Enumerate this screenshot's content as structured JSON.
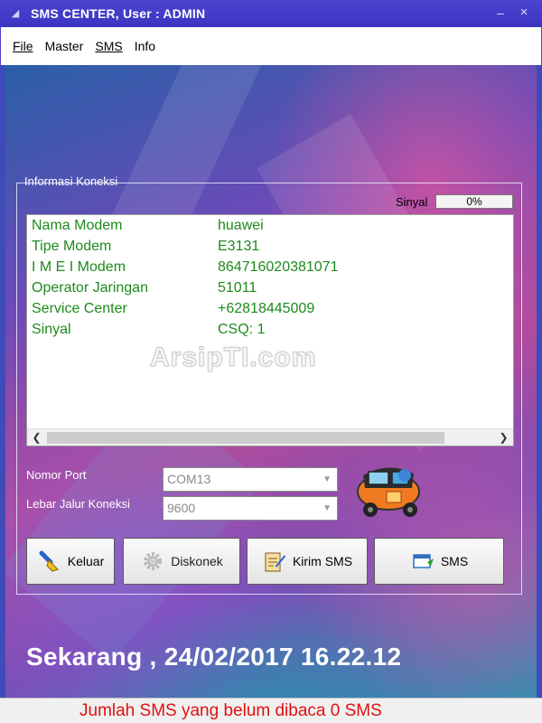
{
  "window": {
    "title": "SMS CENTER, User : ADMIN",
    "minimize_glyph": "–",
    "close_glyph": "×"
  },
  "menu": {
    "items": [
      {
        "label": "File"
      },
      {
        "label": "Master"
      },
      {
        "label": "SMS"
      },
      {
        "label": "Info"
      }
    ]
  },
  "connection": {
    "legend": "Informasi Koneksi",
    "signal_label": "Sinyal",
    "signal_value": "0%",
    "signal_fraction": 0.0,
    "rows": [
      {
        "label": "Nama Modem",
        "value": "huawei"
      },
      {
        "label": "Tipe Modem",
        "value": "E3131"
      },
      {
        "label": "I M E I Modem",
        "value": "864716020381071"
      },
      {
        "label": "Operator Jaringan",
        "value": "51011"
      },
      {
        "label": "Service Center",
        "value": "+62818445009"
      },
      {
        "label": "Sinyal",
        "value": "CSQ: 1"
      }
    ],
    "watermark": "ArsipTI.com"
  },
  "form": {
    "port_label": "Nomor Port",
    "port_value": "COM13",
    "baud_label": "Lebar Jalur Koneksi",
    "baud_value": "9600"
  },
  "buttons": {
    "exit": "Keluar",
    "disconnect": "Diskonek",
    "send_sms": "Kirim SMS",
    "sms": "SMS"
  },
  "clock_text": "Sekarang , 24/02/2017 16.22.12",
  "status_text": "Jumlah SMS yang belum dibaca 0 SMS",
  "colors": {
    "title_bar": "#3b35c2",
    "info_text": "#1d8a1d",
    "status_text": "#e01010"
  },
  "icons": {
    "app": "app-icon",
    "exit": "brush-exit-icon",
    "disconnect": "gear-icon",
    "send_sms": "compose-icon",
    "sms": "message-window-icon",
    "logo": "bajaj-vehicle-icon"
  }
}
